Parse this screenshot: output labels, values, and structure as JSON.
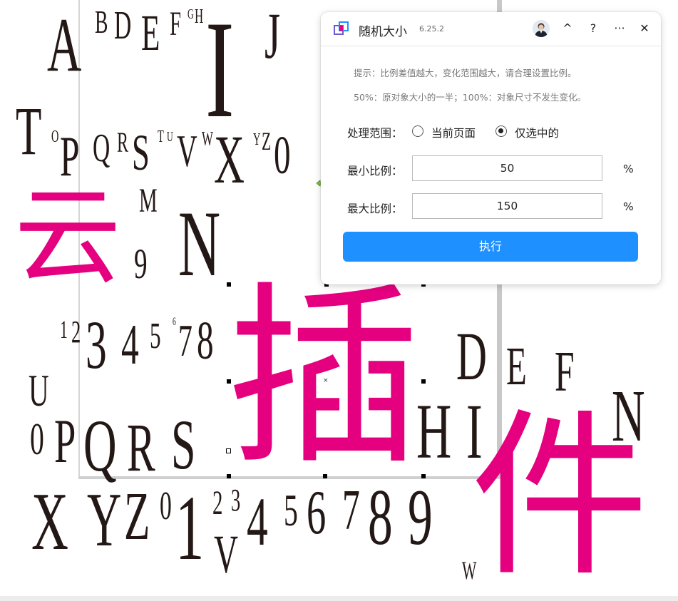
{
  "panel": {
    "title": "随机大小",
    "version": "6.25.2",
    "buttons": {
      "collapse": "^",
      "help": "?",
      "more": "···",
      "close": "✕"
    },
    "tips": [
      "提示：比例差值越大，变化范围越大，请合理设置比例。",
      "50%：原对象大小的一半；100%：对象尺寸不发生变化。"
    ],
    "scope": {
      "label": "处理范围：",
      "options": [
        {
          "label": "当前页面",
          "checked": false
        },
        {
          "label": "仅选中的",
          "checked": true
        }
      ]
    },
    "min_scale": {
      "label": "最小比例：",
      "value": "50",
      "unit": "%"
    },
    "max_scale": {
      "label": "最大比例：",
      "value": "150",
      "unit": "%"
    },
    "run_label": "执行"
  },
  "canvas": {
    "glyphs": {
      "g1": "A",
      "g2": "B",
      "g3": "D",
      "g4": "E",
      "g5": "F",
      "g6": "G",
      "g7": "H",
      "g8": "I",
      "g9": "J",
      "g10": "T",
      "g11": "O",
      "g12": "P",
      "g13": "Q",
      "g14": "R",
      "g15": "S",
      "g16": "T",
      "g17": "U",
      "g18": "V",
      "g19": "W",
      "g20": "X",
      "g21": "Y",
      "g22": "Z",
      "g23": "0",
      "g24": "M",
      "g25": "云",
      "g26": "9",
      "g27": "N",
      "g28": "1",
      "g29": "2",
      "g30": "3",
      "g31": "4",
      "g32": "5",
      "g33": "6",
      "g34": "7",
      "g35": "8",
      "g36": "插",
      "g37": "D",
      "g38": "E",
      "g39": "F",
      "g40": "U",
      "g41": "0",
      "g42": "P",
      "g43": "Q",
      "g44": "R",
      "g45": "S",
      "g46": "H",
      "g47": "I",
      "g48": "N",
      "g49": "件",
      "g50": "X",
      "g51": "Y",
      "g52": "Z",
      "g53": "0",
      "g54": "1",
      "g55": "2",
      "g56": "3",
      "g57": "4",
      "g58": "5",
      "g59": "6",
      "g60": "7",
      "g61": "8",
      "g62": "9",
      "g63": "V",
      "g64": "W"
    },
    "selection_center": "×"
  },
  "colors": {
    "accent": "#1e90ff",
    "glyph": "#231815",
    "cjk": "#e4007f",
    "move_cursor": "#7dc242"
  }
}
